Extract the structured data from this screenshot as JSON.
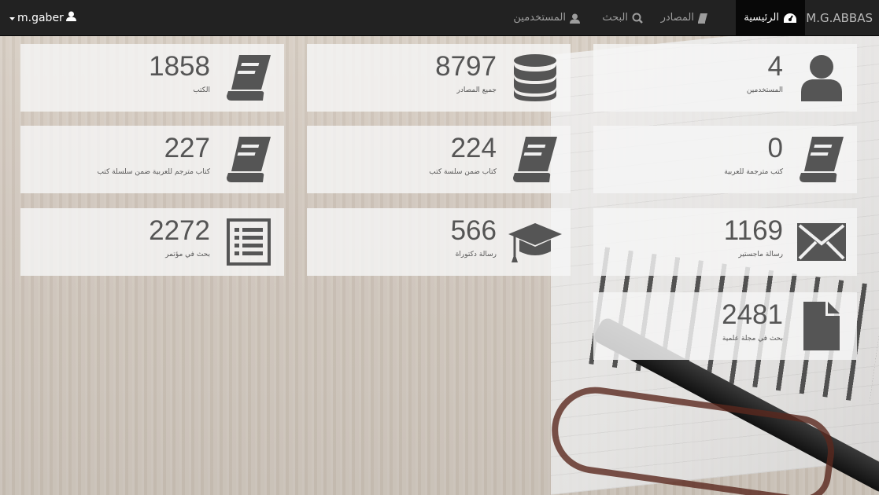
{
  "navbar": {
    "brand": "M.G.ABBAS",
    "items": [
      {
        "label": "الرئيسية",
        "icon": "dashboard-icon",
        "active": true
      },
      {
        "label": "المصادر",
        "icon": "book-icon",
        "active": false
      },
      {
        "label": "البحث",
        "icon": "search-icon",
        "active": false
      },
      {
        "label": "المستخدمين",
        "icon": "user-icon",
        "active": false
      }
    ],
    "user": "m.gaber"
  },
  "cards": [
    {
      "value": "4",
      "label": "المستخدمين",
      "icon": "user-icon"
    },
    {
      "value": "8797",
      "label": "جميع المصادر",
      "icon": "database-icon"
    },
    {
      "value": "1858",
      "label": "الكتب",
      "icon": "book-icon"
    },
    {
      "value": "0",
      "label": "كتب مترجمة للعربية",
      "icon": "book-icon"
    },
    {
      "value": "224",
      "label": "كتاب ضمن سلسة كتب",
      "icon": "book-icon"
    },
    {
      "value": "227",
      "label": "كتاب مترجم للعربية ضمن سلسلة كتب",
      "icon": "book-icon"
    },
    {
      "value": "1169",
      "label": "رسالة ماجستير",
      "icon": "envelope-icon"
    },
    {
      "value": "566",
      "label": "رسالة دكتوراة",
      "icon": "graduation-cap-icon"
    },
    {
      "value": "2272",
      "label": "بحث في مؤتمر",
      "icon": "list-icon"
    },
    {
      "value": "2481",
      "label": "بحث في مجلة علمية",
      "icon": "file-icon"
    }
  ],
  "colors": {
    "navbar_bg": "#222222",
    "active_bg": "#080808",
    "card_bg": "#f5f5f5",
    "icon_color": "#555555"
  }
}
